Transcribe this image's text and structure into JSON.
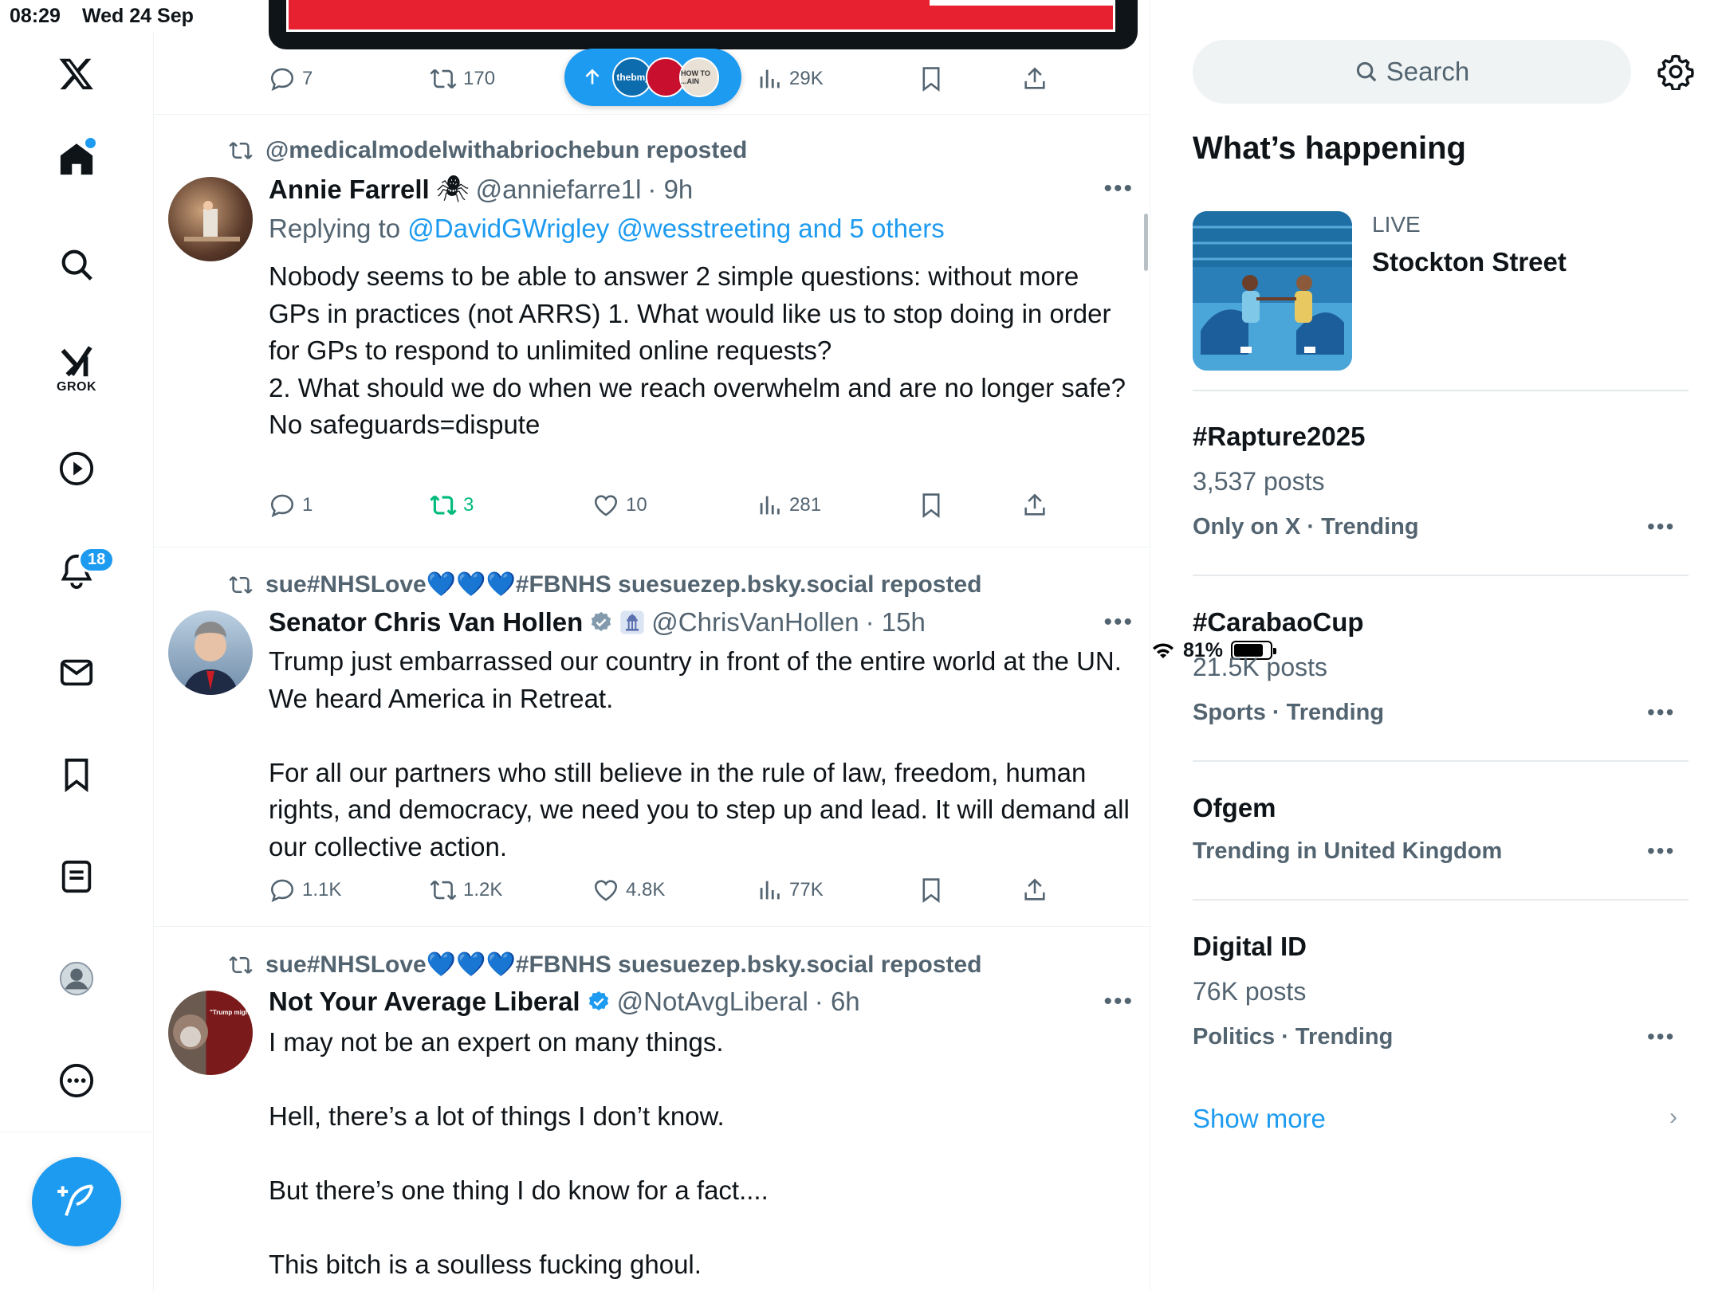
{
  "status_bar": {
    "time": "08:29",
    "date": "Wed 24 Sep",
    "battery": "81%",
    "battery_level": 0.81
  },
  "nav": {
    "grok_label": "GROK",
    "notifications_badge": "18",
    "icons": [
      "x-logo-icon",
      "home-icon",
      "search-icon",
      "grok-icon",
      "video-icon",
      "notifications-icon",
      "messages-icon",
      "bookmarks-icon",
      "lists-icon",
      "profile-icon",
      "more-icon",
      "compose-icon"
    ]
  },
  "new_posts_pill": {
    "label_1": "thebmj",
    "label_2": "HOW TO ...AIN"
  },
  "top_tweet": {
    "replies": "7",
    "reposts": "170",
    "views": "29K"
  },
  "tweets": [
    {
      "reposted_by": "@medicalmodelwithabriochebun reposted",
      "name": "Annie Farrell",
      "name_emoji": "🕷",
      "handle": "@anniefarre1l",
      "time": "· 9h",
      "replying_prefix": "Replying to ",
      "replying_to": "@DavidGWrigley @wesstreeting and 5 others",
      "text": "Nobody seems to be able to answer 2 simple questions: without more GPs in practices (not ARRS) 1. What would like us to stop doing in order for GPs to respond to unlimited online requests?\n2. What should we do when we reach overwhelm and are no longer safe?\nNo safeguards=dispute",
      "replies": "1",
      "reposts": "3",
      "likes": "10",
      "views": "281"
    },
    {
      "reposted_by": "sue#NHSLove💙💙💙#FBNHS suesuezep.bsky.social reposted",
      "name": "Senator Chris Van Hollen",
      "handle": "@ChrisVanHollen",
      "time": "· 15h",
      "text": "Trump just embarrassed our country in front of the entire world at the UN. We heard America in Retreat.\n\nFor all our partners who still believe in the rule of law, freedom, human rights, and democracy, we need you to step up and lead. It will demand all our collective action.",
      "replies": "1.1K",
      "reposts": "1.2K",
      "likes": "4.8K",
      "views": "77K"
    },
    {
      "reposted_by": "sue#NHSLove💙💙💙#FBNHS suesuezep.bsky.social reposted",
      "name": "Not Your Average Liberal",
      "handle": "@NotAvgLiberal",
      "time": "· 6h",
      "avatar_text": "\"Trump might be America's Hitler\"",
      "text": "I may not be an expert on many things.\n\nHell, there’s a lot of things I don’t know.\n\nBut there’s one thing I do know for a fact....\n\nThis bitch is a soulless fucking ghoul."
    }
  ],
  "sidebar": {
    "search_placeholder": "Search",
    "whats_happening": "What’s happening",
    "live": {
      "label": "LIVE",
      "title": "Stockton Street"
    },
    "trends": [
      {
        "title": "#Rapture2025",
        "posts": "3,537 posts",
        "meta": "Only on X · Trending"
      },
      {
        "title": "#CarabaoCup",
        "posts": "21.5K posts",
        "meta": "Sports · Trending"
      },
      {
        "title": "Ofgem",
        "posts": "",
        "meta": "Trending in United Kingdom"
      },
      {
        "title": "Digital ID",
        "posts": "76K posts",
        "meta": "Politics · Trending"
      }
    ],
    "show_more": "Show more"
  },
  "colors": {
    "accent": "#1d9bf0",
    "repost_green": "#00ba7c",
    "muted": "#536471"
  }
}
